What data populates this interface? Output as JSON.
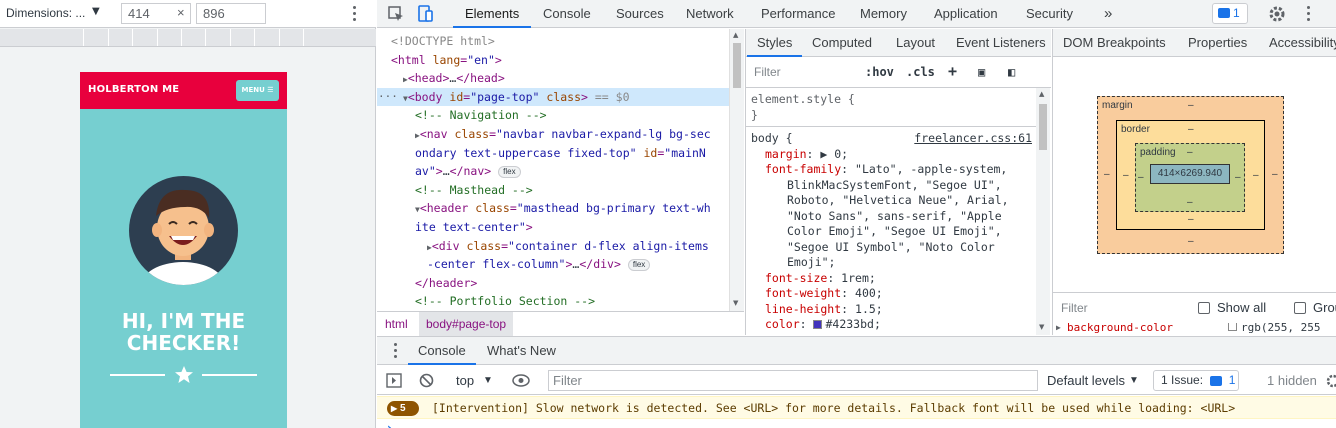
{
  "device_toolbar": {
    "dimensions_label": "Dimensions: ...",
    "width": "414",
    "height": "896",
    "separator": "×"
  },
  "site": {
    "brand": "HOLBERTON ME",
    "menu_label": "MENU ☰",
    "hero_text": "HI, I'M THE CHECKER!",
    "colors": {
      "nav": "#e8003d",
      "primary": "#76cfd0",
      "avatar_bg": "#2d3e50"
    }
  },
  "devtools": {
    "tabs": [
      "Elements",
      "Console",
      "Sources",
      "Network",
      "Performance",
      "Memory",
      "Application",
      "Security"
    ],
    "more_tabs": "»",
    "issues_count": "1",
    "active_tab": "Elements"
  },
  "dom_tree": {
    "lines": [
      {
        "indent": 0,
        "html": "<span class=\"dx\">&lt;!DOCTYPE html&gt;</span>"
      },
      {
        "indent": 0,
        "html": "<span class=\"tg\">&lt;html</span> <span class=\"at\">lang</span><span class=\"tg\">=</span><span class=\"av\">\"en\"</span><span class=\"tg\">&gt;</span>"
      },
      {
        "indent": 1,
        "html": "<span class=\"tri\">▶</span><span class=\"tg\">&lt;head&gt;</span>…<span class=\"tg\">&lt;/head&gt;</span>"
      },
      {
        "indent": 1,
        "html": "<span class=\"tri\">▼</span><span class=\"tg\">&lt;body</span> <span class=\"at\">id</span><span class=\"tg\">=</span><span class=\"av\">\"page-top\"</span> <span class=\"at\">class</span><span class=\"tg\">&gt;</span> <span class=\"dx\">== $0</span>"
      },
      {
        "indent": 2,
        "html": "<span class=\"cm\">&lt;!-- Navigation --&gt;</span>"
      },
      {
        "indent": 2,
        "html": "<span class=\"tri\">▶</span><span class=\"tg\">&lt;nav</span> <span class=\"at\">class</span><span class=\"tg\">=</span><span class=\"av\">\"navbar navbar-expand-lg bg-sec</span>"
      },
      {
        "indent": 2,
        "html": "<span class=\"av\">ondary text-uppercase fixed-top\"</span> <span class=\"at\">id</span><span class=\"tg\">=</span><span class=\"av\">\"mainN</span>"
      },
      {
        "indent": 2,
        "html": "<span class=\"av\">av\"</span><span class=\"tg\">&gt;</span>…<span class=\"tg\">&lt;/nav&gt;</span> <span class=\"pill\">flex</span>"
      },
      {
        "indent": 2,
        "html": "<span class=\"cm\">&lt;!-- Masthead --&gt;</span>"
      },
      {
        "indent": 2,
        "html": "<span class=\"tri\">▼</span><span class=\"tg\">&lt;header</span> <span class=\"at\">class</span><span class=\"tg\">=</span><span class=\"av\">\"masthead bg-primary text-wh</span>"
      },
      {
        "indent": 2,
        "html": "<span class=\"av\">ite text-center\"</span><span class=\"tg\">&gt;</span>"
      },
      {
        "indent": 3,
        "html": "<span class=\"tri\">▶</span><span class=\"tg\">&lt;div</span> <span class=\"at\">class</span><span class=\"tg\">=</span><span class=\"av\">\"container d-flex align-items</span>"
      },
      {
        "indent": 3,
        "html": "<span class=\"av\">-center flex-column\"</span><span class=\"tg\">&gt;</span>…<span class=\"tg\">&lt;/div&gt;</span> <span class=\"pill\">flex</span>"
      },
      {
        "indent": 2,
        "html": "<span class=\"tg\">&lt;/header&gt;</span>"
      },
      {
        "indent": 2,
        "html": "<span class=\"cm\">&lt;!-- Portfolio Section --&gt;</span>"
      }
    ],
    "selected_marker": "···",
    "breadcrumbs": [
      "html",
      "body#page-top"
    ]
  },
  "styles_pane": {
    "tabs": [
      "Styles",
      "Computed",
      "Layout",
      "Event Listeners",
      "DOM Breakpoints",
      "Properties",
      "Accessibility"
    ],
    "filter_placeholder": "Filter",
    "hov": ":hov",
    "cls": ".cls",
    "element_style_open": "element.style {",
    "element_style_close": "}",
    "body_selector": "body {",
    "body_source": "freelancer.css:61",
    "declarations": [
      {
        "prop": "margin",
        "value": "▶ 0;"
      },
      {
        "prop": "font-family",
        "value": "\"Lato\", -apple-system,"
      },
      {
        "prop": "",
        "value": "BlinkMacSystemFont, \"Segoe UI\","
      },
      {
        "prop": "",
        "value": "Roboto, \"Helvetica Neue\", Arial,"
      },
      {
        "prop": "",
        "value": "\"Noto Sans\", sans-serif, \"Apple"
      },
      {
        "prop": "",
        "value": "Color Emoji\", \"Segoe UI Emoji\","
      },
      {
        "prop": "",
        "value": "\"Segoe UI Symbol\", \"Noto Color"
      },
      {
        "prop": "",
        "value": "Emoji\";"
      },
      {
        "prop": "font-size",
        "value": "1rem;"
      },
      {
        "prop": "font-weight",
        "value": "400;"
      },
      {
        "prop": "line-height",
        "value": "1.5;"
      },
      {
        "prop": "color",
        "value": "#4233bd;"
      }
    ],
    "color_swatch": "#4233bd"
  },
  "box_model": {
    "margin_label": "margin",
    "border_label": "border",
    "padding_label": "padding",
    "dash": "–",
    "content_size": "414×6269.940",
    "colors": {
      "margin": "#f9cc9d",
      "border": "#fddd9b",
      "padding": "#c3d08b",
      "content": "#8cb6c0"
    },
    "filter_placeholder": "Filter",
    "show_all": "Show all",
    "group": "Group",
    "computed_row_prop": "background-color",
    "computed_row_value": "rgb(255, 255"
  },
  "drawer": {
    "tabs": [
      "Console",
      "What's New"
    ],
    "context": "top",
    "filter_placeholder": "Filter",
    "levels": "Default levels",
    "issue_label": "1 Issue:",
    "issue_count": "1",
    "hidden": "1 hidden",
    "warning_count": "5",
    "warning_message": "[Intervention] Slow network is detected. See <URL> for more details. Fallback font will be used while loading: <URL>",
    "prompt": "›"
  }
}
